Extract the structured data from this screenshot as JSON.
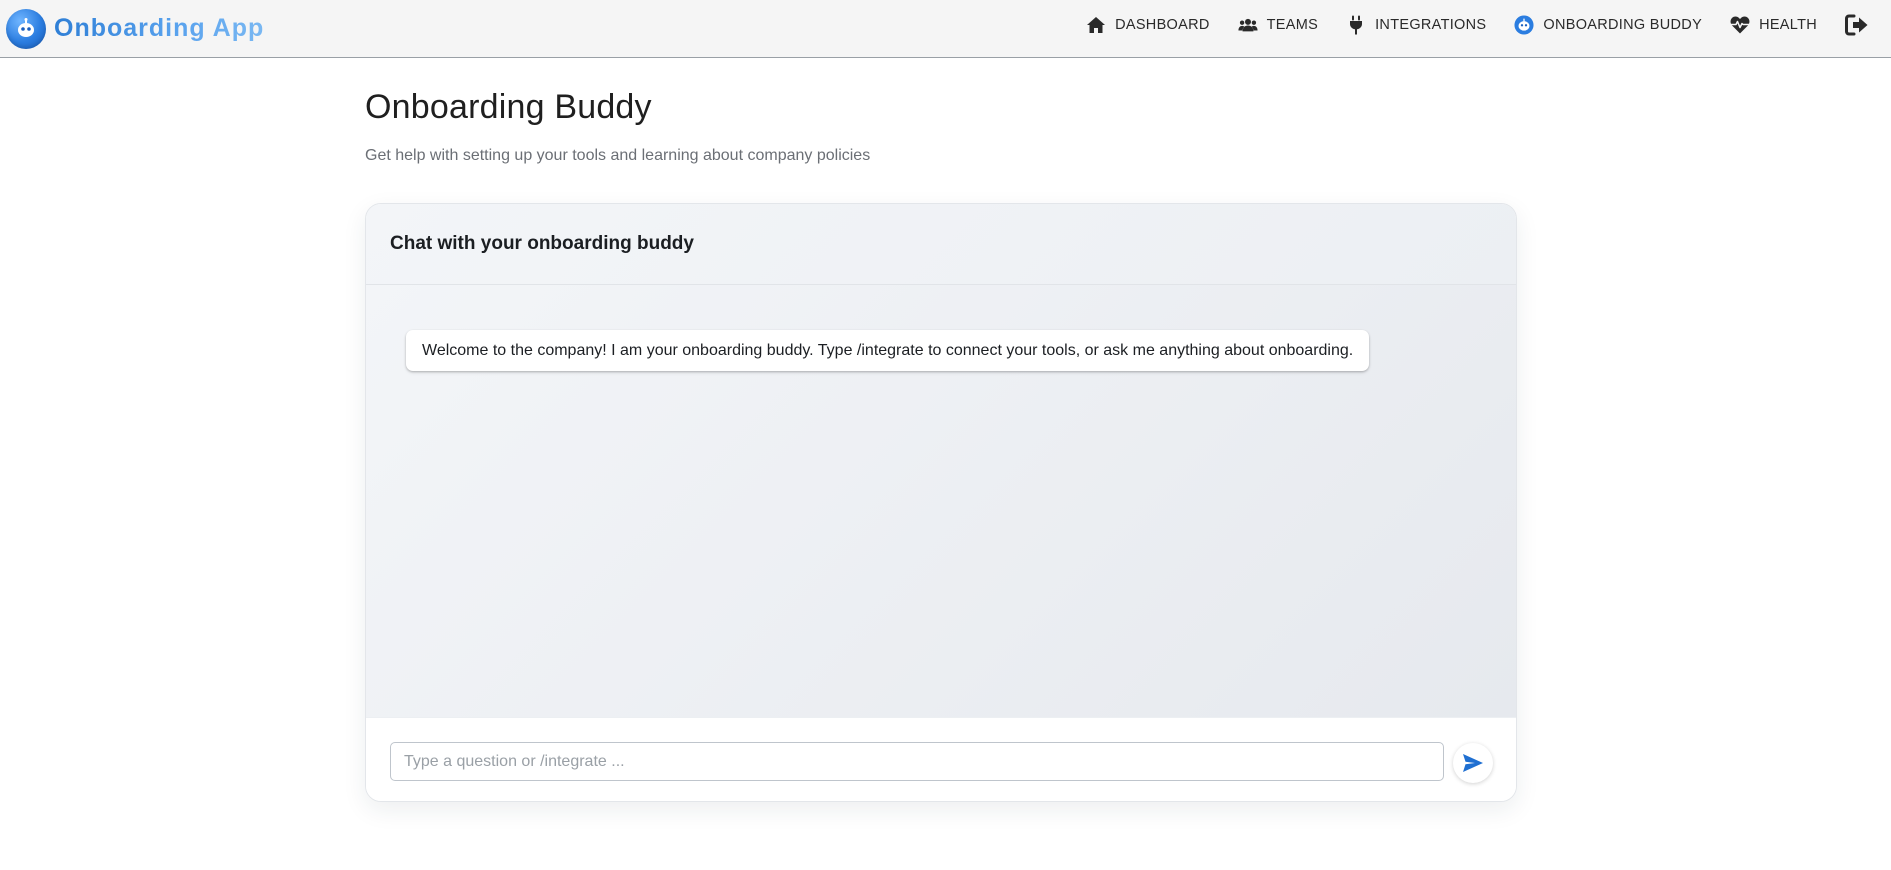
{
  "brand": {
    "name": "Onboarding App",
    "logo_icon": "robot-face-icon"
  },
  "nav": {
    "items": [
      {
        "label": "DASHBOARD",
        "icon": "home-icon"
      },
      {
        "label": "TEAMS",
        "icon": "users-icon"
      },
      {
        "label": "INTEGRATIONS",
        "icon": "plug-icon"
      },
      {
        "label": "ONBOARDING BUDDY",
        "icon": "robot-face-icon"
      },
      {
        "label": "HEALTH",
        "icon": "heartbeat-icon"
      }
    ],
    "logout_icon": "sign-out-icon"
  },
  "page": {
    "title": "Onboarding Buddy",
    "subtitle": "Get help with setting up your tools and learning about company policies"
  },
  "chat": {
    "header_title": "Chat with your onboarding buddy",
    "messages": [
      {
        "sender": "bot",
        "text": "Welcome to the company! I am your onboarding buddy. Type /integrate to connect your tools, or ask me anything about onboarding."
      }
    ],
    "input": {
      "value": "",
      "placeholder": "Type a question or /integrate ..."
    },
    "send_icon": "send-icon"
  },
  "colors": {
    "accent": "#1f6fd1",
    "brand_gradient_start": "#2f7fd6",
    "brand_gradient_end": "#7ab8f2",
    "nav_background": "#f5f5f5"
  }
}
